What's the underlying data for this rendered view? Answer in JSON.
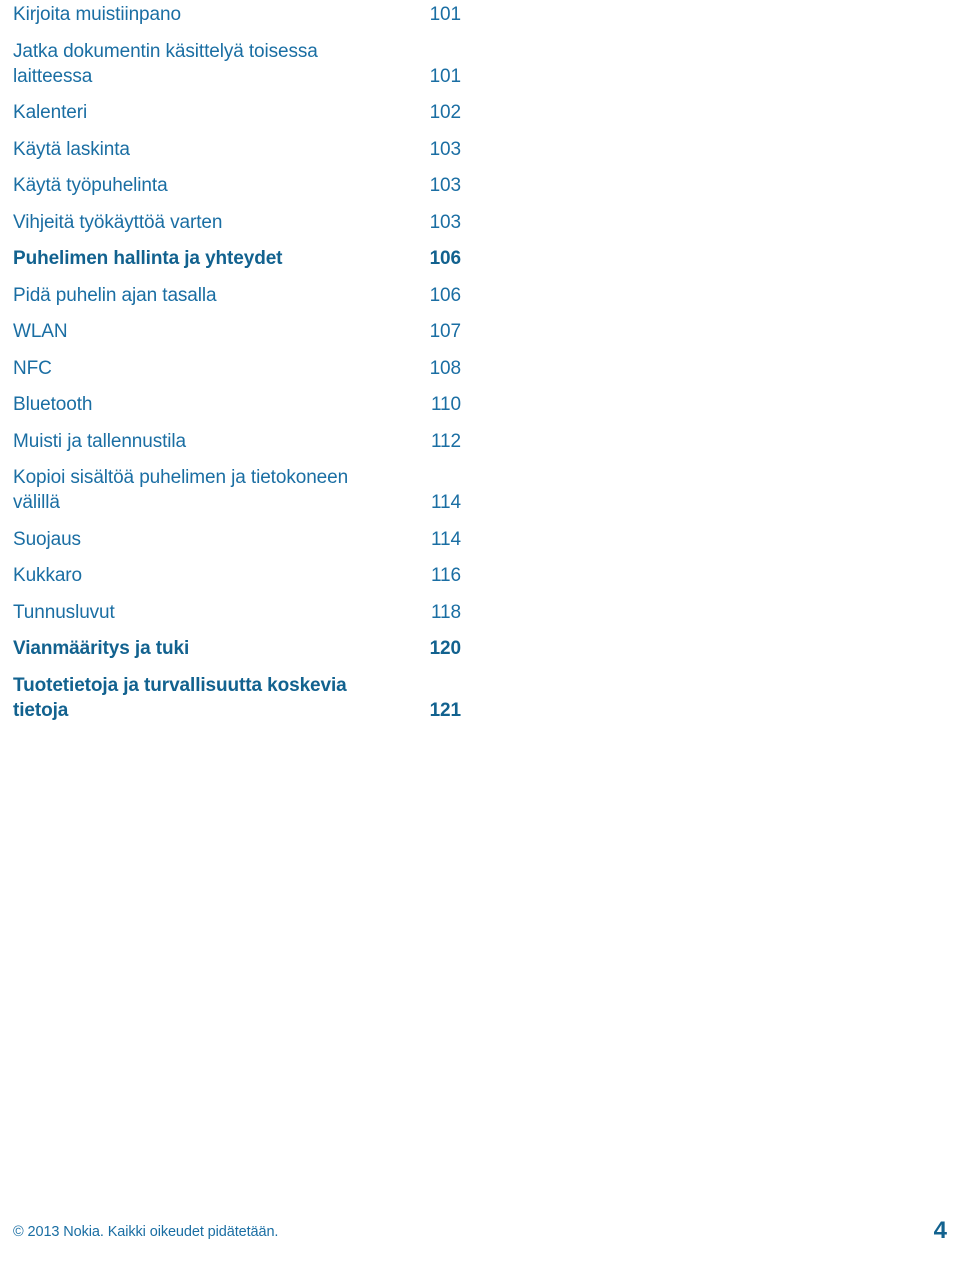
{
  "document": {
    "type": "table-of-contents",
    "language": "fi",
    "background_color": "#ffffff",
    "text_color": "#1a6ea3",
    "bold_text_color": "#12628f"
  },
  "toc": {
    "entries": [
      {
        "title": "Kirjoita muistiinpano",
        "page": "101",
        "bold": false
      },
      {
        "title": "Jatka dokumentin käsittelyä toisessa laitteessa",
        "page": "101",
        "bold": false
      },
      {
        "title": "Kalenteri",
        "page": "102",
        "bold": false
      },
      {
        "title": "Käytä laskinta",
        "page": "103",
        "bold": false
      },
      {
        "title": "Käytä työpuhelinta",
        "page": "103",
        "bold": false
      },
      {
        "title": "Vihjeitä työkäyttöä varten",
        "page": "103",
        "bold": false
      },
      {
        "title": "Puhelimen hallinta ja yhteydet",
        "page": "106",
        "bold": true
      },
      {
        "title": "Pidä puhelin ajan tasalla",
        "page": "106",
        "bold": false
      },
      {
        "title": "WLAN",
        "page": "107",
        "bold": false
      },
      {
        "title": "NFC",
        "page": "108",
        "bold": false
      },
      {
        "title": "Bluetooth",
        "page": "110",
        "bold": false
      },
      {
        "title": "Muisti ja tallennustila",
        "page": "112",
        "bold": false
      },
      {
        "title": "Kopioi sisältöä puhelimen ja tietokoneen välillä",
        "page": "114",
        "bold": false
      },
      {
        "title": "Suojaus",
        "page": "114",
        "bold": false
      },
      {
        "title": "Kukkaro",
        "page": "116",
        "bold": false
      },
      {
        "title": "Tunnusluvut",
        "page": "118",
        "bold": false
      },
      {
        "title": "Vianmääritys ja tuki",
        "page": "120",
        "bold": true
      },
      {
        "title": "Tuotetietoja ja turvallisuutta koskevia tietoja",
        "page": "121",
        "bold": true
      }
    ]
  },
  "footer": {
    "copyright": "© 2013 Nokia. Kaikki oikeudet pidätetään.",
    "page_number": "4"
  }
}
